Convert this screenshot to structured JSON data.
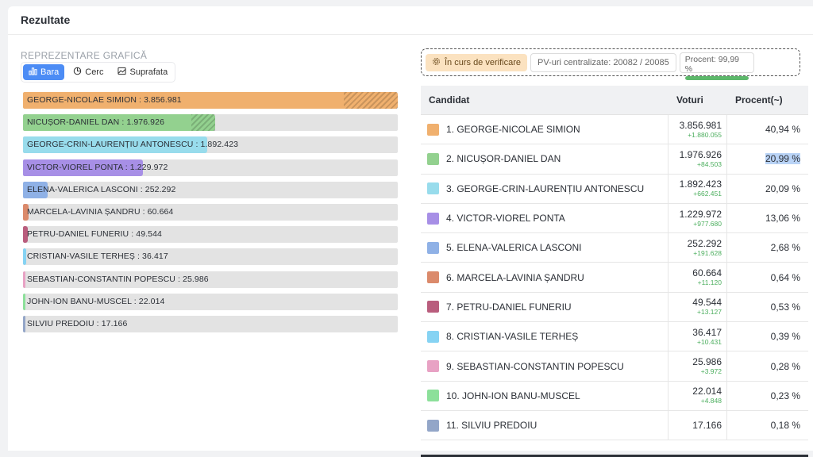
{
  "header": {
    "title": "Rezultate"
  },
  "chart_section": {
    "title": "REPREZENTARE GRAFICĂ",
    "tabs": [
      {
        "label": "Bara",
        "active": true,
        "icon": "bar-chart-icon"
      },
      {
        "label": "Cerc",
        "active": false,
        "icon": "pie-chart-icon"
      },
      {
        "label": "Suprafata",
        "active": false,
        "icon": "area-chart-icon"
      }
    ]
  },
  "status": {
    "verification_label": "În curs de verificare",
    "pv_label": "PV-uri centralizate: 20082 / 20085",
    "percent_label": "Procent: 99,99 %",
    "percent_value": 99.99,
    "percent_color": "#5db86b"
  },
  "table": {
    "headers": {
      "candidate": "Candidat",
      "votes": "Voturi",
      "percent": "Procent(~)"
    },
    "rows": [
      {
        "name": "1. GEORGE-NICOLAE SIMION",
        "votes": "3.856.981",
        "delta": "+1.880.055",
        "percent": "40,94 %",
        "color": "#f0b06e"
      },
      {
        "name": "2. NICUȘOR-DANIEL DAN",
        "votes": "1.976.926",
        "delta": "+84.503",
        "percent": "20,99 %",
        "color": "#93d18f",
        "highlight": true
      },
      {
        "name": "3. GEORGE-CRIN-LAURENȚIU ANTONESCU",
        "votes": "1.892.423",
        "delta": "+662.451",
        "percent": "20,09 %",
        "color": "#98dcec"
      },
      {
        "name": "4. VICTOR-VIOREL PONTA",
        "votes": "1.229.972",
        "delta": "+977.680",
        "percent": "13,06 %",
        "color": "#a78fe6"
      },
      {
        "name": "5. ELENA-VALERICA LASCONI",
        "votes": "252.292",
        "delta": "+191.628",
        "percent": "2,68 %",
        "color": "#8fb1e6"
      },
      {
        "name": "6. MARCELA-LAVINIA ȘANDRU",
        "votes": "60.664",
        "delta": "+11.120",
        "percent": "0,64 %",
        "color": "#db8a6b"
      },
      {
        "name": "7. PETRU-DANIEL FUNERIU",
        "votes": "49.544",
        "delta": "+13.127",
        "percent": "0,53 %",
        "color": "#b95d7d"
      },
      {
        "name": "8. CRISTIAN-VASILE TERHEȘ",
        "votes": "36.417",
        "delta": "+10.431",
        "percent": "0,39 %",
        "color": "#86d3f3"
      },
      {
        "name": "9. SEBASTIAN-CONSTANTIN POPESCU",
        "votes": "25.986",
        "delta": "+3.972",
        "percent": "0,28 %",
        "color": "#e8a2c4"
      },
      {
        "name": "10. JOHN-ION BANU-MUSCEL",
        "votes": "22.014",
        "delta": "+4.848",
        "percent": "0,23 %",
        "color": "#8ce09a"
      },
      {
        "name": "11. SILVIU PREDOIU",
        "votes": "17.166",
        "delta": "",
        "percent": "0,18 %",
        "color": "#93a6c8"
      }
    ]
  },
  "chart_data": {
    "type": "bar",
    "orientation": "horizontal",
    "categories": [
      "GEORGE-NICOLAE SIMION",
      "NICUȘOR-DANIEL DAN",
      "GEORGE-CRIN-LAURENȚIU ANTONESCU",
      "VICTOR-VIOREL PONTA",
      "ELENA-VALERICA LASCONI",
      "MARCELA-LAVINIA ȘANDRU",
      "PETRU-DANIEL FUNERIU",
      "CRISTIAN-VASILE TERHEȘ",
      "SEBASTIAN-CONSTANTIN POPESCU",
      "JOHN-ION BANU-MUSCEL",
      "SILVIU PREDOIU"
    ],
    "values": [
      3856981,
      1976926,
      1892423,
      1229972,
      252292,
      60664,
      49544,
      36417,
      25986,
      22014,
      17166
    ],
    "labels": [
      "GEORGE-NICOLAE SIMION : 3.856.981",
      "NICUȘOR-DANIEL DAN : 1.976.926",
      "GEORGE-CRIN-LAURENȚIU ANTONESCU : 1.892.423",
      "VICTOR-VIOREL PONTA : 1.229.972",
      "ELENA-VALERICA LASCONI : 252.292",
      "MARCELA-LAVINIA ȘANDRU : 60.664",
      "PETRU-DANIEL FUNERIU : 49.544",
      "CRISTIAN-VASILE TERHEȘ : 36.417",
      "SEBASTIAN-CONSTANTIN POPESCU : 25.986",
      "JOHN-ION BANU-MUSCEL : 22.014",
      "SILVIU PREDOIU : 17.166"
    ],
    "colors": [
      "#f0b06e",
      "#93d18f",
      "#98dcec",
      "#a78fe6",
      "#8fb1e6",
      "#db8a6b",
      "#b95d7d",
      "#86d3f3",
      "#e8a2c4",
      "#8ce09a",
      "#93a6c8"
    ],
    "hatched_increment_bars": [
      0,
      1
    ],
    "grid": false
  }
}
